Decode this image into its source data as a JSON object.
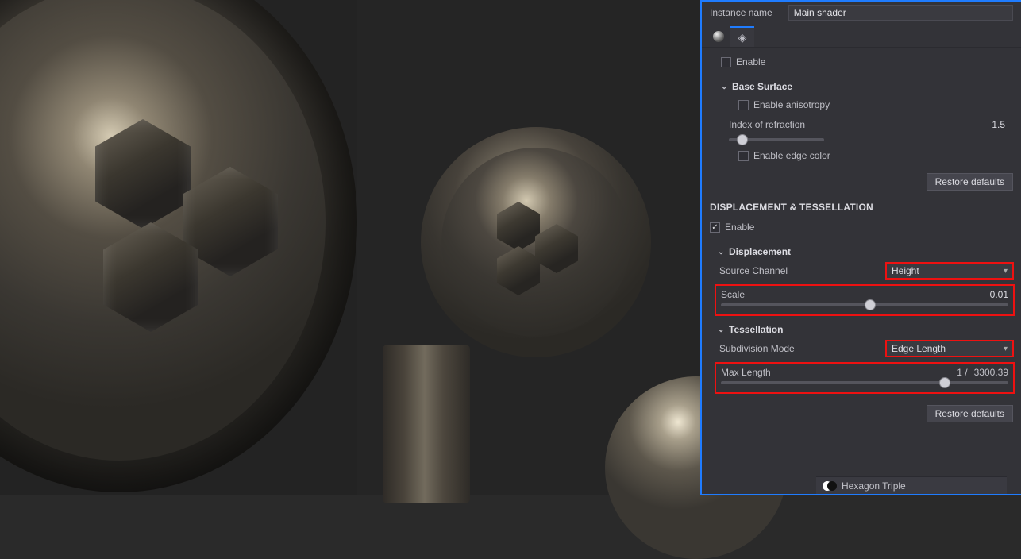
{
  "instance": {
    "label": "Instance name",
    "value": "Main shader"
  },
  "tabs": {
    "sphere_name": "sphere-icon",
    "shader_name": "shader-icon"
  },
  "top_section": {
    "enable_label": "Enable",
    "base_surface_label": "Base Surface",
    "enable_anisotropy_label": "Enable anisotropy",
    "ior_label": "Index of refraction",
    "ior_value": "1.5",
    "enable_edge_color_label": "Enable edge color",
    "restore_label": "Restore defaults"
  },
  "disp": {
    "header": "DISPLACEMENT & TESSELLATION",
    "enable_label": "Enable",
    "displacement_label": "Displacement",
    "source_channel_label": "Source Channel",
    "source_channel_value": "Height",
    "scale_label": "Scale",
    "scale_value": "0.01",
    "tessellation_label": "Tessellation",
    "subdivision_mode_label": "Subdivision Mode",
    "subdivision_mode_value": "Edge Length",
    "max_length_label": "Max Length",
    "max_length_left": "1 /",
    "max_length_right": "3300.39",
    "restore_label": "Restore defaults"
  },
  "footer": {
    "layer_name": "Hexagon Triple"
  }
}
